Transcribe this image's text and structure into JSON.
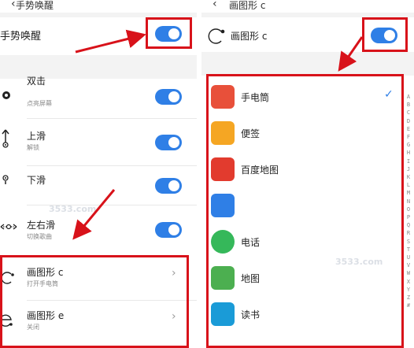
{
  "left": {
    "header_title": "手势唤醒",
    "master": {
      "label": "手势唤醒",
      "on": true
    },
    "gestures": [
      {
        "title": "双击",
        "subtitle": "点亮屏幕",
        "on": true
      },
      {
        "title": "上滑",
        "subtitle": "解锁",
        "on": true
      },
      {
        "title": "下滑",
        "subtitle": "",
        "on": true
      },
      {
        "title": "左右滑",
        "subtitle": "切换歌曲",
        "on": true
      }
    ],
    "shapes": [
      {
        "title": "画图形 c",
        "subtitle": "打开手电筒"
      },
      {
        "title": "画图形 e",
        "subtitle": "关闭"
      }
    ]
  },
  "right": {
    "header_title": "画图形 c",
    "shape_label": "画图形 c",
    "shape_on": true,
    "apps": [
      {
        "name": "手电筒",
        "icon": "flashlight-icon",
        "color": "#e8503a",
        "selected": true
      },
      {
        "name": "便签",
        "icon": "notes-icon",
        "color": "#f5a623",
        "selected": false
      },
      {
        "name": "百度地图",
        "icon": "baidu-map-icon",
        "color": "#e23b2e",
        "selected": false
      },
      {
        "name": "",
        "icon": "app-icon",
        "color": "#2f7fe6",
        "selected": false
      },
      {
        "name": "电话",
        "icon": "phone-icon",
        "color": "#35b85a",
        "selected": false
      },
      {
        "name": "地图",
        "icon": "map-icon",
        "color": "#4caf50",
        "selected": false
      },
      {
        "name": "读书",
        "icon": "book-icon",
        "color": "#1a9bd7",
        "selected": false
      }
    ],
    "alphabet": [
      "A",
      "B",
      "C",
      "D",
      "E",
      "F",
      "G",
      "H",
      "I",
      "J",
      "K",
      "L",
      "M",
      "N",
      "O",
      "P",
      "Q",
      "R",
      "S",
      "T",
      "U",
      "V",
      "W",
      "X",
      "Y",
      "Z",
      "#"
    ]
  },
  "watermark": "3533.com",
  "colors": {
    "accent": "#2f7fe6",
    "highlight": "#d8121a"
  }
}
